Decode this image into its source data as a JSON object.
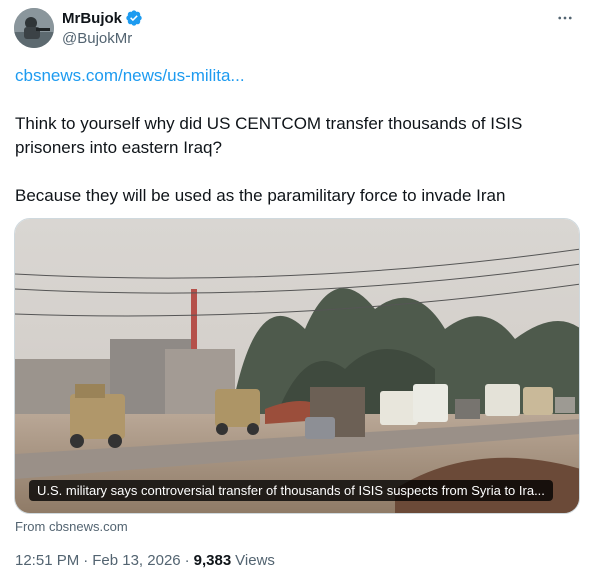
{
  "author": {
    "display_name": "MrBujok",
    "handle": "@BujokMr",
    "verified": true
  },
  "more_icon": "more-horizontal-icon",
  "tweet": {
    "link_text": "cbsnews.com/news/us-milita...",
    "paragraph_1": "Think to yourself why did US CENTCOM transfer thousands of ISIS prisoners into eastern Iraq?",
    "paragraph_2": "Because they will be used as the paramilitary force to invade Iran"
  },
  "card": {
    "caption": "U.S. military says controversial transfer of thousands of ISIS suspects from Syria to Ira...",
    "source": "From cbsnews.com"
  },
  "meta": {
    "time": "12:51 PM",
    "separator": "·",
    "date": "Feb 13, 2026",
    "views_count": "9,383",
    "views_label": "Views"
  },
  "colors": {
    "link": "#1d9bf0",
    "verified": "#1d9bf0",
    "secondary_text": "#536471"
  }
}
